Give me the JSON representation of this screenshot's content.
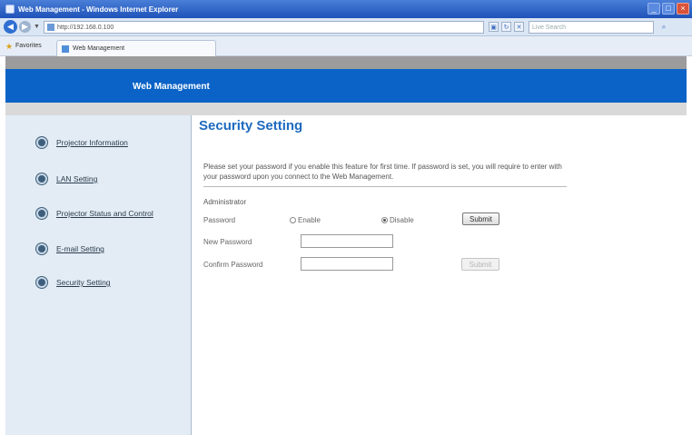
{
  "window": {
    "title": "Web Management - Windows Internet Explorer",
    "controls": [
      "_",
      "□",
      "×"
    ]
  },
  "address_bar": {
    "url": "http://192.168.0.100",
    "search_placeholder": "Live Search"
  },
  "favorites": {
    "label": "Favorites",
    "tab_title": "Web Management"
  },
  "banner": {
    "title": "Web Management"
  },
  "sidebar": {
    "items": [
      {
        "label": "Projector Information"
      },
      {
        "label": "LAN Setting"
      },
      {
        "label": "Projector Status and Control"
      },
      {
        "label": "E-mail Setting"
      },
      {
        "label": "Security Setting"
      }
    ]
  },
  "main": {
    "title": "Security Setting",
    "intro": "Please set your password if you enable this feature for first time. If password is set, you will require to enter with your password upon you connect to the Web Management.",
    "section_label": "Administrator",
    "password_label": "Password",
    "enable_label": "Enable",
    "disable_label": "Disable",
    "selected": "Disable",
    "submit_label": "Submit",
    "new_password_label": "New Password",
    "confirm_password_label": "Confirm Password",
    "new_password_value": "",
    "confirm_password_value": "",
    "submit2_label": "Submit"
  },
  "colors": {
    "banner": "#0b63c7",
    "title": "#1d6ac0",
    "sidebar": "#e3ecf4"
  }
}
